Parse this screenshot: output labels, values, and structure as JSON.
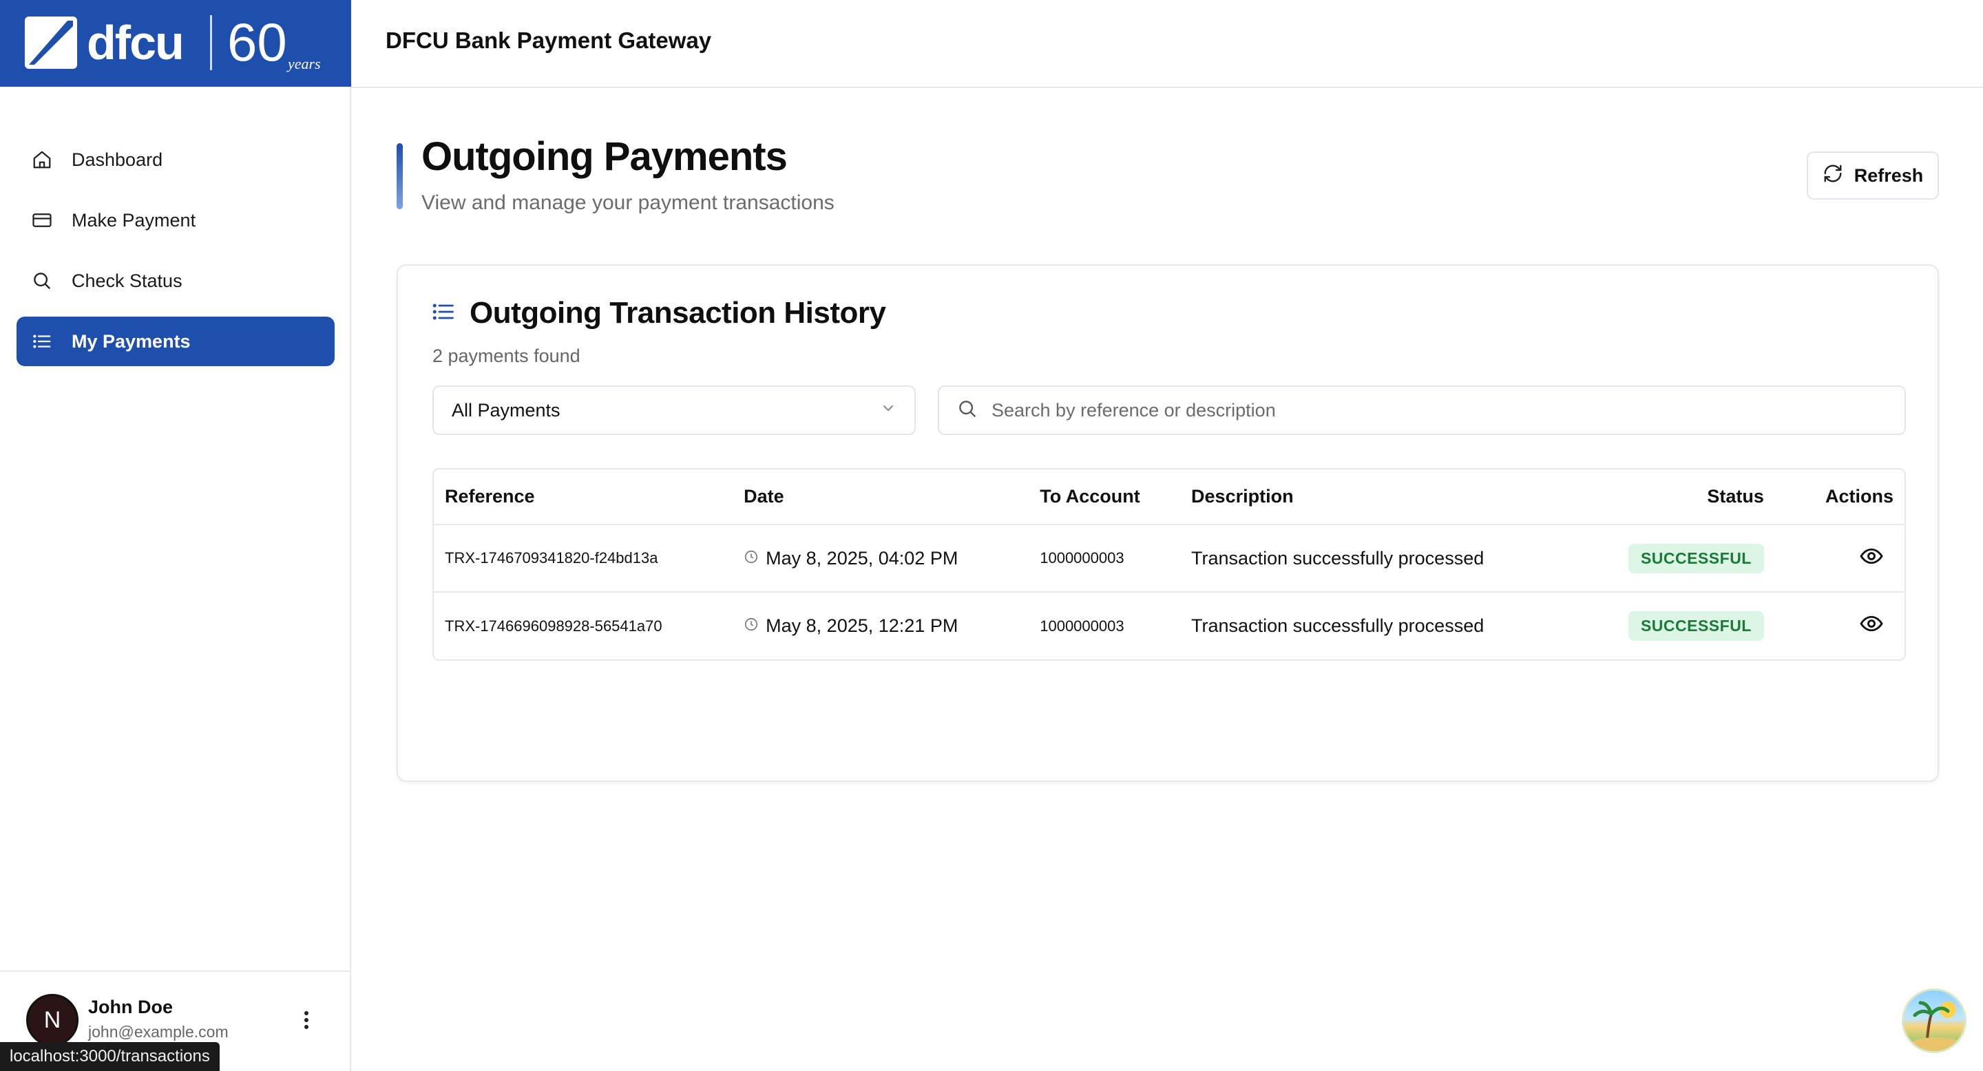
{
  "brand": {
    "wordmark": "dfcu",
    "anniversary": "60",
    "anniversary_script": "years"
  },
  "sidebar": {
    "items": [
      {
        "label": "Dashboard",
        "icon": "home-icon"
      },
      {
        "label": "Make Payment",
        "icon": "card-icon"
      },
      {
        "label": "Check Status",
        "icon": "search-icon"
      },
      {
        "label": "My Payments",
        "icon": "list-icon",
        "active": true
      }
    ]
  },
  "user": {
    "initial": "N",
    "name": "John Doe",
    "email": "john@example.com"
  },
  "status_url": "localhost:3000/transactions",
  "header": {
    "title": "DFCU Bank Payment Gateway"
  },
  "page": {
    "title": "Outgoing Payments",
    "subtitle": "View and manage your payment transactions",
    "refresh_label": "Refresh"
  },
  "card": {
    "title": "Outgoing Transaction History",
    "count": "2 payments found",
    "filter_selected": "All Payments",
    "search_placeholder": "Search by reference or description"
  },
  "table": {
    "headers": {
      "reference": "Reference",
      "date": "Date",
      "account": "To Account",
      "description": "Description",
      "status": "Status",
      "actions": "Actions"
    },
    "rows": [
      {
        "reference": "TRX-1746709341820-f24bd13a",
        "date": "May 8, 2025, 04:02 PM",
        "account": "1000000003",
        "description": "Transaction successfully processed",
        "status": "SUCCESSFUL"
      },
      {
        "reference": "TRX-1746696098928-56541a70",
        "date": "May 8, 2025, 12:21 PM",
        "account": "1000000003",
        "description": "Transaction successfully processed",
        "status": "SUCCESSFUL"
      }
    ]
  },
  "colors": {
    "primary": "#1f4fad",
    "success_bg": "#dcf5e4",
    "success_text": "#1a7a3a"
  }
}
